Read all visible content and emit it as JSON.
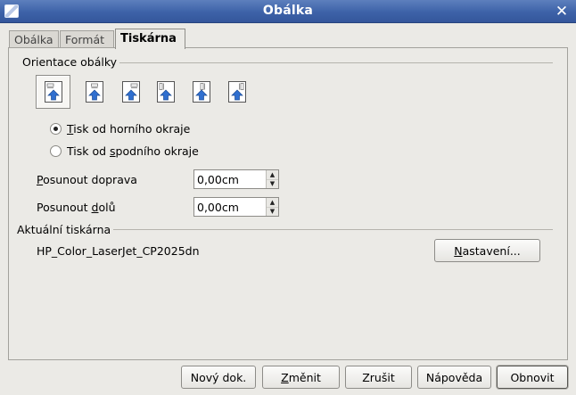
{
  "window": {
    "title": "Obálka"
  },
  "tabs": [
    {
      "label": "Obálka"
    },
    {
      "label": "Formát"
    },
    {
      "label": "Tiskárna"
    }
  ],
  "orientation": {
    "heading": "Orientace obálky",
    "options": [
      {
        "icon": "envelope-orientation-icon-1",
        "selected": true
      },
      {
        "icon": "envelope-orientation-icon-2",
        "selected": false
      },
      {
        "icon": "envelope-orientation-icon-3",
        "selected": false
      },
      {
        "icon": "envelope-orientation-icon-4",
        "selected": false
      },
      {
        "icon": "envelope-orientation-icon-5",
        "selected": false
      },
      {
        "icon": "envelope-orientation-icon-6",
        "selected": false
      }
    ]
  },
  "print_side": {
    "top": {
      "pre": "",
      "key": "T",
      "post": "isk od horního okraje",
      "checked": true
    },
    "bottom": {
      "pre": "Tisk od ",
      "key": "s",
      "post": "podního okraje",
      "checked": false
    }
  },
  "shift": {
    "right": {
      "key": "P",
      "post": "osunout doprava",
      "value": "0,00cm"
    },
    "down": {
      "pre": "Posunout ",
      "key": "d",
      "post": "olů",
      "value": "0,00cm"
    }
  },
  "printer": {
    "heading": "Aktuální tiskárna",
    "name": "HP_Color_LaserJet_CP2025dn",
    "settings": {
      "key": "N",
      "post": "astavení..."
    }
  },
  "buttons": {
    "new_doc": "Nový dok.",
    "change": {
      "key": "Z",
      "post": "měnit"
    },
    "cancel": "Zrušit",
    "help": "Nápověda",
    "reset": "Obnovit"
  },
  "colors": {
    "titlebar": "#3d62a8",
    "dialog_bg": "#ebeae6",
    "icon_arrow": "#2f6fd0"
  }
}
